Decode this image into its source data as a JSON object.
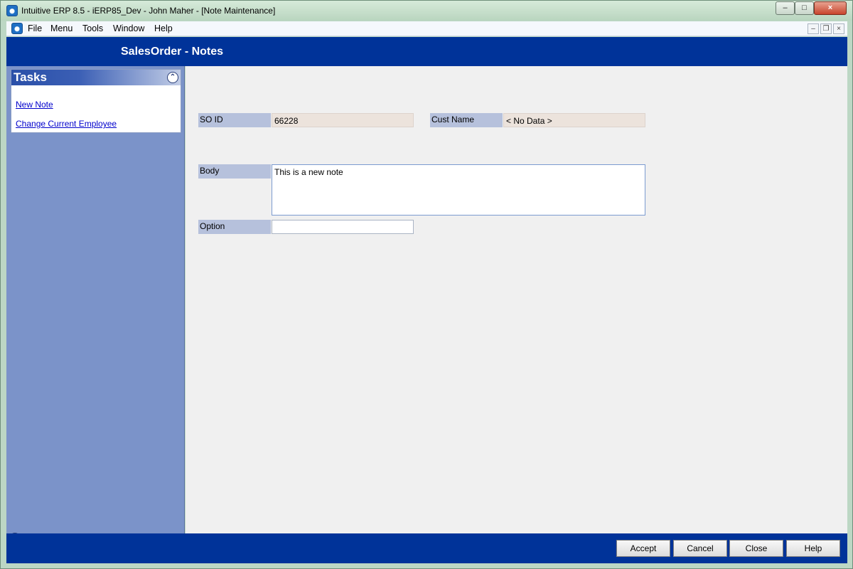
{
  "window": {
    "title": "Intuitive ERP 8.5 - iERP85_Dev - John Maher - [Note Maintenance]",
    "minimize": "–",
    "restore": "□",
    "close": "×"
  },
  "menubar": {
    "items": [
      "File",
      "Menu",
      "Tools",
      "Window",
      "Help"
    ],
    "mdi_minimize": "–",
    "mdi_restore": "❐",
    "mdi_close": "×"
  },
  "header": {
    "title": "SalesOrder - Notes"
  },
  "tasks": {
    "title": "Tasks",
    "collapse_glyph": "⌃",
    "links": [
      "New Note",
      "Change Current Employee"
    ],
    "expand_glyph": "«"
  },
  "form": {
    "so_id_label": "SO ID",
    "so_id_value": "66228",
    "cust_name_label": "Cust Name",
    "cust_name_value": "< No Data >",
    "body_label": "Body",
    "body_value": "This is a new note",
    "option_label": "Option",
    "option_value": ""
  },
  "footer": {
    "buttons": [
      "Accept",
      "Cancel",
      "Close",
      "Help"
    ]
  },
  "colors": {
    "header_bg": "#003399",
    "sidebar_bg": "#7b93c9",
    "label_bg": "#b6c1dc",
    "readonly_bg": "#ece3dc",
    "link": "#0000cc"
  }
}
